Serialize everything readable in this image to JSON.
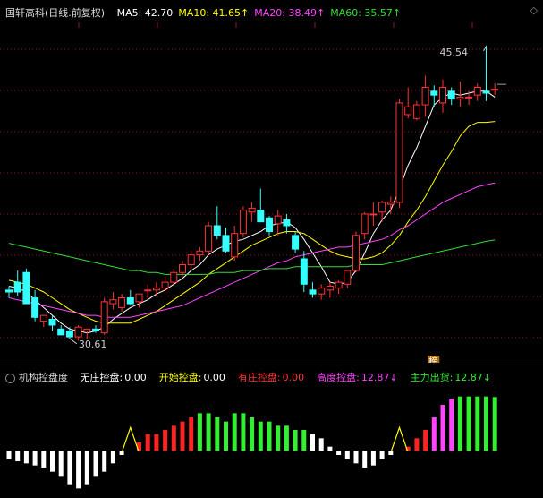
{
  "main": {
    "title": "国轩高科",
    "period": "(日线.前复权)",
    "ma": [
      {
        "label": "MA5:",
        "value": "42.70",
        "color": "#ffffff",
        "arrow": ""
      },
      {
        "label": "MA10:",
        "value": "41.65",
        "color": "#ffff00",
        "arrow": "↑"
      },
      {
        "label": "MA20:",
        "value": "38.49",
        "color": "#ff44ff",
        "arrow": "↑"
      },
      {
        "label": "MA60:",
        "value": "35.57",
        "color": "#33dd33",
        "arrow": "↑"
      }
    ],
    "controls": "◇",
    "high_label": "45.54",
    "low_label": "30.61",
    "badge": "榜"
  },
  "indicator": {
    "name": "机构控盘度",
    "items": [
      {
        "label": "无庄控盘:",
        "value": "0.00",
        "color": "#ffffff",
        "arrow": ""
      },
      {
        "label": "开始控盘:",
        "value": "0.00",
        "color": "#ffff00",
        "arrow": ""
      },
      {
        "label": "有庄控盘:",
        "value": "0.00",
        "color": "#ff3333",
        "arrow": ""
      },
      {
        "label": "高度控盘:",
        "value": "12.87",
        "color": "#ff44ff",
        "arrow": "↓"
      },
      {
        "label": "主力出货:",
        "value": "12.87",
        "color": "#33ee33",
        "arrow": "↓"
      }
    ]
  },
  "chart_data": [
    {
      "type": "candlestick",
      "title": "国轩高科 (日线.前复权)",
      "x": [
        1,
        2,
        3,
        4,
        5,
        6,
        7,
        8,
        9,
        10,
        11,
        12,
        13,
        14,
        15,
        16,
        17,
        18,
        19,
        20,
        21,
        22,
        23,
        24,
        25,
        26,
        27,
        28,
        29,
        30,
        31,
        32,
        33,
        34,
        35,
        36,
        37,
        38,
        39,
        40,
        41,
        42,
        43,
        44,
        45,
        46,
        47,
        48,
        49,
        50,
        51,
        52,
        53,
        54,
        55,
        56,
        57
      ],
      "ohlc": [
        [
          33.0,
          33.2,
          32.6,
          32.9
        ],
        [
          33.4,
          34.0,
          32.7,
          32.9
        ],
        [
          33.9,
          34.1,
          32.5,
          32.3
        ],
        [
          32.6,
          33.0,
          31.4,
          31.6
        ],
        [
          31.4,
          31.7,
          31.1,
          31.7
        ],
        [
          31.5,
          31.7,
          30.9,
          31.2
        ],
        [
          31.0,
          31.2,
          30.8,
          30.7
        ],
        [
          30.9,
          31.1,
          30.5,
          30.6
        ],
        [
          30.6,
          31.2,
          30.4,
          31.1
        ],
        [
          30.9,
          31.0,
          30.5,
          31.0
        ],
        [
          31.0,
          31.2,
          30.8,
          30.9
        ],
        [
          30.8,
          32.6,
          30.7,
          32.4
        ],
        [
          32.3,
          32.9,
          32.0,
          32.5
        ],
        [
          32.1,
          32.8,
          31.9,
          32.6
        ],
        [
          32.6,
          33.0,
          32.2,
          32.3
        ],
        [
          32.4,
          32.8,
          32.1,
          32.8
        ],
        [
          33.0,
          33.3,
          32.6,
          33.0
        ],
        [
          33.0,
          33.4,
          32.7,
          33.1
        ],
        [
          33.1,
          33.7,
          32.9,
          33.4
        ],
        [
          33.4,
          34.1,
          33.3,
          33.9
        ],
        [
          33.9,
          34.5,
          33.7,
          34.3
        ],
        [
          34.3,
          35.0,
          34.1,
          34.8
        ],
        [
          34.8,
          35.2,
          34.5,
          35.0
        ],
        [
          35.0,
          36.5,
          34.8,
          36.3
        ],
        [
          36.3,
          37.3,
          35.6,
          35.8
        ],
        [
          35.8,
          36.2,
          34.9,
          35.0
        ],
        [
          34.7,
          36.3,
          34.5,
          35.9
        ],
        [
          35.9,
          37.3,
          35.7,
          37.1
        ],
        [
          37.0,
          37.5,
          36.5,
          37.2
        ],
        [
          37.1,
          38.2,
          36.5,
          36.5
        ],
        [
          36.7,
          36.8,
          35.8,
          36.0
        ],
        [
          36.4,
          37.1,
          35.8,
          36.8
        ],
        [
          36.6,
          36.9,
          35.9,
          36.3
        ],
        [
          35.8,
          36.0,
          34.9,
          35.1
        ],
        [
          34.6,
          35.0,
          32.9,
          33.3
        ],
        [
          33.0,
          33.4,
          32.6,
          32.8
        ],
        [
          32.8,
          33.3,
          32.5,
          33.1
        ],
        [
          33.0,
          33.4,
          32.6,
          33.2
        ],
        [
          33.1,
          33.5,
          32.8,
          33.4
        ],
        [
          33.3,
          34.0,
          33.1,
          34.0
        ],
        [
          34.0,
          36.0,
          33.9,
          35.8
        ],
        [
          35.9,
          37.0,
          35.6,
          36.9
        ],
        [
          36.9,
          37.5,
          36.3,
          36.9
        ],
        [
          37.0,
          37.6,
          36.5,
          37.5
        ],
        [
          37.4,
          37.8,
          36.9,
          37.5
        ],
        [
          37.5,
          42.8,
          37.2,
          42.6
        ],
        [
          42.0,
          43.4,
          41.8,
          42.4
        ],
        [
          41.8,
          42.7,
          41.7,
          42.5
        ],
        [
          42.5,
          44.0,
          41.9,
          43.4
        ],
        [
          43.2,
          43.5,
          42.4,
          43.0
        ],
        [
          42.6,
          43.8,
          42.1,
          43.4
        ],
        [
          43.2,
          43.4,
          42.5,
          42.8
        ],
        [
          42.8,
          43.7,
          42.4,
          42.9
        ],
        [
          42.9,
          43.2,
          42.5,
          42.9
        ],
        [
          43.0,
          43.6,
          42.7,
          43.4
        ],
        [
          43.2,
          45.54,
          42.7,
          43.1
        ],
        [
          43.3,
          43.6,
          43.0,
          43.3
        ]
      ],
      "ma": {
        "MA5": [
          33.2,
          33.1,
          32.9,
          32.5,
          32.1,
          31.7,
          31.3,
          31.0,
          30.9,
          30.8,
          30.9,
          31.1,
          31.5,
          31.8,
          32.1,
          32.3,
          32.5,
          32.8,
          33.0,
          33.3,
          33.6,
          34.0,
          34.3,
          34.8,
          35.1,
          35.3,
          35.5,
          35.6,
          35.8,
          36.0,
          36.3,
          36.4,
          36.5,
          36.2,
          35.6,
          34.9,
          34.2,
          33.4,
          33.3,
          33.4,
          34.0,
          34.9,
          35.9,
          36.6,
          37.1,
          38.2,
          39.4,
          40.3,
          41.4,
          42.5,
          42.9,
          43.1,
          43.0,
          43.1,
          43.2,
          43.2,
          42.9
        ],
        "MA10": [
          33.5,
          33.4,
          33.3,
          33.1,
          32.9,
          32.6,
          32.3,
          32.0,
          31.8,
          31.6,
          31.4,
          31.3,
          31.3,
          31.3,
          31.3,
          31.5,
          31.7,
          31.9,
          32.2,
          32.5,
          32.8,
          33.1,
          33.4,
          33.8,
          34.1,
          34.4,
          34.7,
          35.0,
          35.3,
          35.5,
          35.7,
          35.9,
          36.0,
          36.0,
          35.9,
          35.6,
          35.3,
          35.0,
          34.8,
          34.7,
          34.6,
          34.6,
          34.7,
          34.9,
          35.3,
          35.8,
          36.5,
          37.1,
          37.8,
          38.6,
          39.4,
          40.1,
          40.9,
          41.4,
          41.6,
          41.6,
          41.65
        ],
        "MA20": [
          32.6,
          32.5,
          32.4,
          32.3,
          32.2,
          32.1,
          32.0,
          31.9,
          31.8,
          31.7,
          31.7,
          31.6,
          31.6,
          31.6,
          31.6,
          31.7,
          31.8,
          31.9,
          32.0,
          32.1,
          32.2,
          32.4,
          32.6,
          32.8,
          33.0,
          33.2,
          33.4,
          33.6,
          33.8,
          34.0,
          34.2,
          34.4,
          34.5,
          34.7,
          34.8,
          34.9,
          35.0,
          35.1,
          35.2,
          35.2,
          35.3,
          35.4,
          35.5,
          35.6,
          35.8,
          36.1,
          36.3,
          36.6,
          36.9,
          37.2,
          37.5,
          37.7,
          37.9,
          38.1,
          38.3,
          38.4,
          38.49
        ],
        "MA60": [
          35.4,
          35.3,
          35.2,
          35.1,
          35.0,
          34.9,
          34.8,
          34.7,
          34.6,
          34.5,
          34.4,
          34.3,
          34.2,
          34.1,
          34.0,
          34.0,
          33.9,
          33.9,
          33.8,
          33.8,
          33.8,
          33.8,
          33.8,
          33.8,
          33.9,
          33.9,
          33.9,
          34.0,
          34.0,
          34.0,
          34.1,
          34.1,
          34.1,
          34.2,
          34.2,
          34.2,
          34.2,
          34.2,
          34.2,
          34.2,
          34.3,
          34.3,
          34.3,
          34.3,
          34.4,
          34.5,
          34.6,
          34.7,
          34.8,
          34.9,
          35.0,
          35.1,
          35.2,
          35.3,
          35.4,
          35.5,
          35.57
        ]
      },
      "high_marker": {
        "x": 56,
        "value": 45.54
      },
      "low_marker": {
        "x": 8,
        "value": 30.61
      },
      "ylim": [
        29.5,
        46.5
      ]
    },
    {
      "type": "bar",
      "title": "机构控盘度",
      "categories": [
        1,
        2,
        3,
        4,
        5,
        6,
        7,
        8,
        9,
        10,
        11,
        12,
        13,
        14,
        15,
        16,
        17,
        18,
        19,
        20,
        21,
        22,
        23,
        24,
        25,
        26,
        27,
        28,
        29,
        30,
        31,
        32,
        33,
        34,
        35,
        36,
        37,
        38,
        39,
        40,
        41,
        42,
        43,
        44,
        45,
        46,
        47,
        48,
        49,
        50,
        51,
        52,
        53,
        54,
        55,
        56,
        57
      ],
      "values": [
        -2,
        -2.5,
        -3,
        -3.5,
        -4,
        -5,
        -6,
        -8,
        -9,
        -8,
        -6,
        -5,
        -3,
        -1,
        0,
        2,
        4,
        4,
        5,
        6,
        7,
        8,
        9,
        9,
        8,
        7,
        9,
        9,
        8,
        7,
        7,
        6,
        6,
        5,
        5,
        4,
        3,
        1,
        -1,
        -2,
        -3,
        -4,
        -3.5,
        -2,
        -1,
        0,
        1,
        3,
        5,
        8,
        11,
        12.5,
        13,
        13,
        13,
        13,
        12.87
      ],
      "colors": [
        "white",
        "white",
        "white",
        "white",
        "white",
        "white",
        "white",
        "white",
        "white",
        "white",
        "white",
        "white",
        "white",
        "white",
        "yellow",
        "red",
        "red",
        "red",
        "red",
        "red",
        "red",
        "red",
        "green",
        "green",
        "green",
        "green",
        "green",
        "green",
        "green",
        "green",
        "green",
        "green",
        "green",
        "green",
        "green",
        "white",
        "white",
        "white",
        "white",
        "white",
        "white",
        "white",
        "white",
        "white",
        "white",
        "yellow",
        "red",
        "red",
        "red",
        "magenta",
        "magenta",
        "magenta",
        "green",
        "green",
        "green",
        "green",
        "green"
      ],
      "yellow_markers": [
        15,
        46
      ],
      "ylim": [
        -10,
        14
      ]
    }
  ],
  "colors": {
    "up": "#ff3333",
    "down": "#33ffff",
    "grid": "#8b1a1a",
    "ma5": "#ffffff",
    "ma10": "#ffff00",
    "ma20": "#ff44ff",
    "ma60": "#33dd33",
    "white_bar": "#ffffff",
    "yellow_bar": "#ffff00",
    "red_bar": "#ff2222",
    "magenta_bar": "#ff44ff",
    "green_bar": "#33ee33"
  }
}
